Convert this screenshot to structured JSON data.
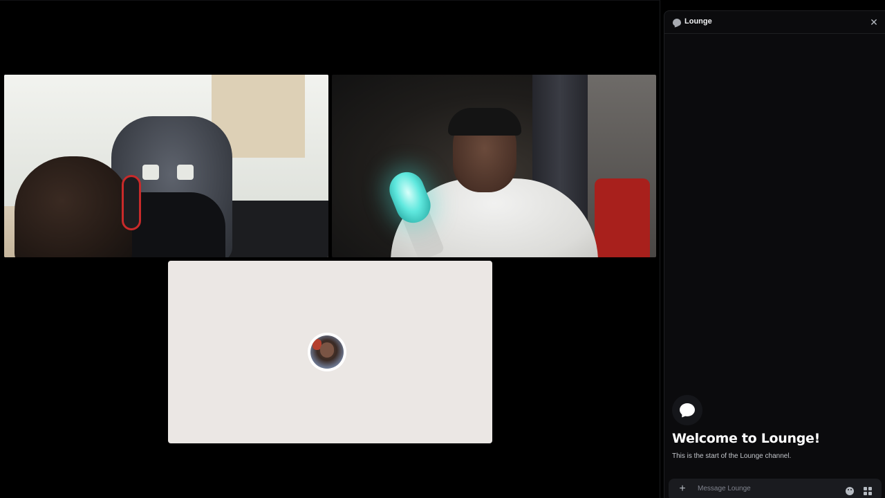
{
  "chat": {
    "channel_name": "Lounge",
    "close_label": "✕",
    "welcome_title": "Welcome to Lounge!",
    "welcome_subtitle": "This is the start of the Lounge channel.",
    "composer": {
      "add_label": "+",
      "placeholder": "Message Lounge"
    },
    "icons": {
      "header": "speech-bubble-icon",
      "welcome": "speech-bubble-icon",
      "close": "close-icon",
      "add": "plus-icon",
      "emoji": "emoji-icon",
      "apps": "apps-icon"
    }
  },
  "stage": {
    "tiles": [
      {
        "id": "participant-1",
        "type": "video"
      },
      {
        "id": "participant-2",
        "type": "video"
      },
      {
        "id": "participant-3",
        "type": "avatar",
        "background": "#ebe7e4"
      }
    ]
  },
  "colors": {
    "background": "#000000",
    "panel": "#0b0b0d",
    "composer": "#1a1b1f",
    "text_primary": "#ffffff",
    "text_muted": "#80848e"
  }
}
